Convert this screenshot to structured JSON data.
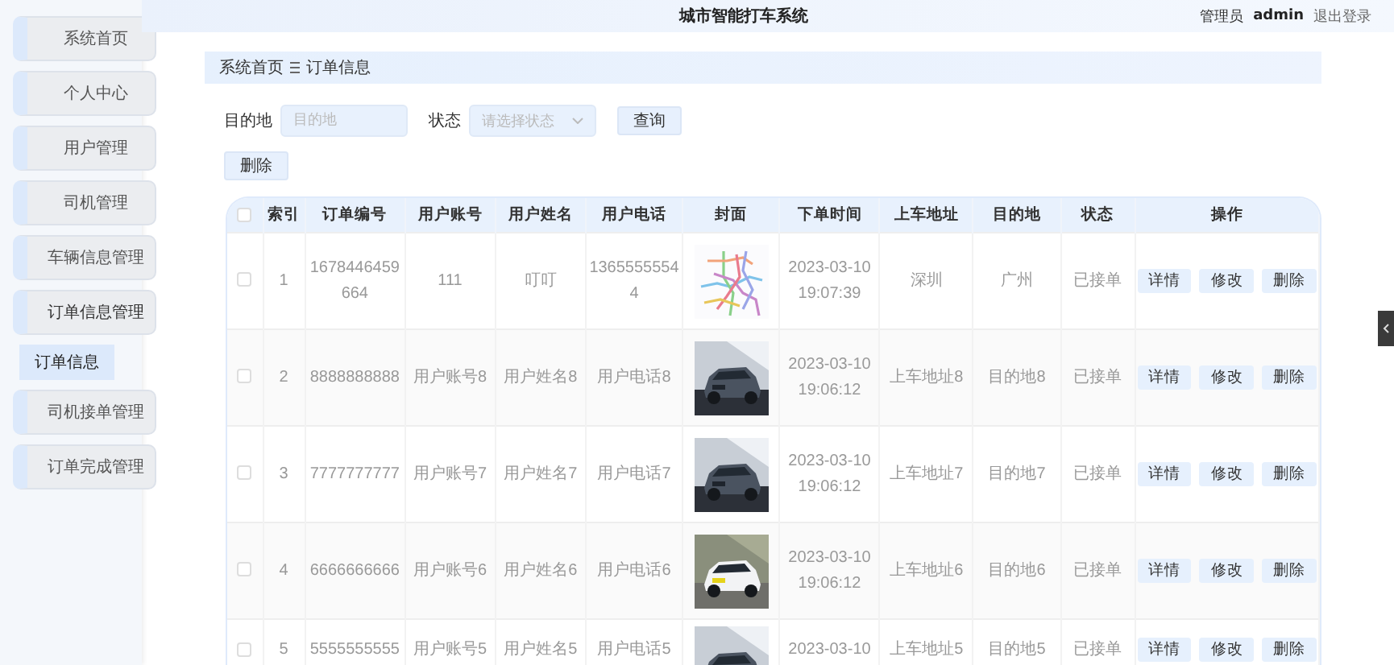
{
  "header": {
    "title": "城市智能打车系统",
    "user_label": "管理员",
    "username": "admin",
    "logout": "退出登录"
  },
  "sidebar": {
    "items": [
      {
        "label": "系统首页",
        "expanded": false
      },
      {
        "label": "个人中心",
        "expanded": false
      },
      {
        "label": "用户管理",
        "expanded": false
      },
      {
        "label": "司机管理",
        "expanded": false
      },
      {
        "label": "车辆信息管理",
        "expanded": false
      },
      {
        "label": "订单信息管理",
        "expanded": true,
        "children": [
          {
            "label": "订单信息",
            "selected": true
          }
        ]
      },
      {
        "label": "司机接单管理",
        "expanded": false
      },
      {
        "label": "订单完成管理",
        "expanded": false
      }
    ]
  },
  "breadcrumb": [
    "系统首页",
    "订单信息"
  ],
  "search": {
    "fields": [
      {
        "label": "目的地",
        "kind": "input",
        "placeholder": "目的地"
      },
      {
        "label": "状态",
        "kind": "select",
        "placeholder": "请选择状态"
      }
    ],
    "button": "查询"
  },
  "toolbar": {
    "delete_button": "删除"
  },
  "table": {
    "header_checked": false,
    "columns": [
      "索引",
      "订单编号",
      "用户账号",
      "用户姓名",
      "用户电话",
      "封面",
      "下单时间",
      "上车地址",
      "目的地",
      "状态",
      "操作"
    ],
    "rows": [
      {
        "checked": false,
        "index": "1",
        "order_no": "1678446459664",
        "account": "111",
        "name": "叮叮",
        "phone": "13655555544",
        "time": "2023-03-10 19:07:39",
        "pickup": "深圳",
        "destination": "广州",
        "status": "已接单",
        "actions": [
          "详情",
          "修改",
          "删除"
        ]
      },
      {
        "checked": false,
        "index": "2",
        "order_no": "8888888888",
        "account": "用户账号8",
        "name": "用户姓名8",
        "phone": "用户电话8",
        "time": "2023-03-10 19:06:12",
        "pickup": "上车地址8",
        "destination": "目的地8",
        "status": "已接单",
        "actions": [
          "详情",
          "修改",
          "删除"
        ]
      },
      {
        "checked": false,
        "index": "3",
        "order_no": "7777777777",
        "account": "用户账号7",
        "name": "用户姓名7",
        "phone": "用户电话7",
        "time": "2023-03-10 19:06:12",
        "pickup": "上车地址7",
        "destination": "目的地7",
        "status": "已接单",
        "actions": [
          "详情",
          "修改",
          "删除"
        ]
      },
      {
        "checked": false,
        "index": "4",
        "order_no": "6666666666",
        "account": "用户账号6",
        "name": "用户姓名6",
        "phone": "用户电话6",
        "time": "2023-03-10 19:06:12",
        "pickup": "上车地址6",
        "destination": "目的地6",
        "status": "已接单",
        "actions": [
          "详情",
          "修改",
          "删除"
        ]
      },
      {
        "checked": false,
        "index": "5",
        "order_no": "5555555555",
        "account": "用户账号5",
        "name": "用户姓名5",
        "phone": "用户电话5",
        "time": "2023-03-10",
        "pickup": "上车地址5",
        "destination": "目的地5",
        "status": "已接单",
        "actions": [
          "详情",
          "修改",
          "删除"
        ]
      }
    ]
  }
}
